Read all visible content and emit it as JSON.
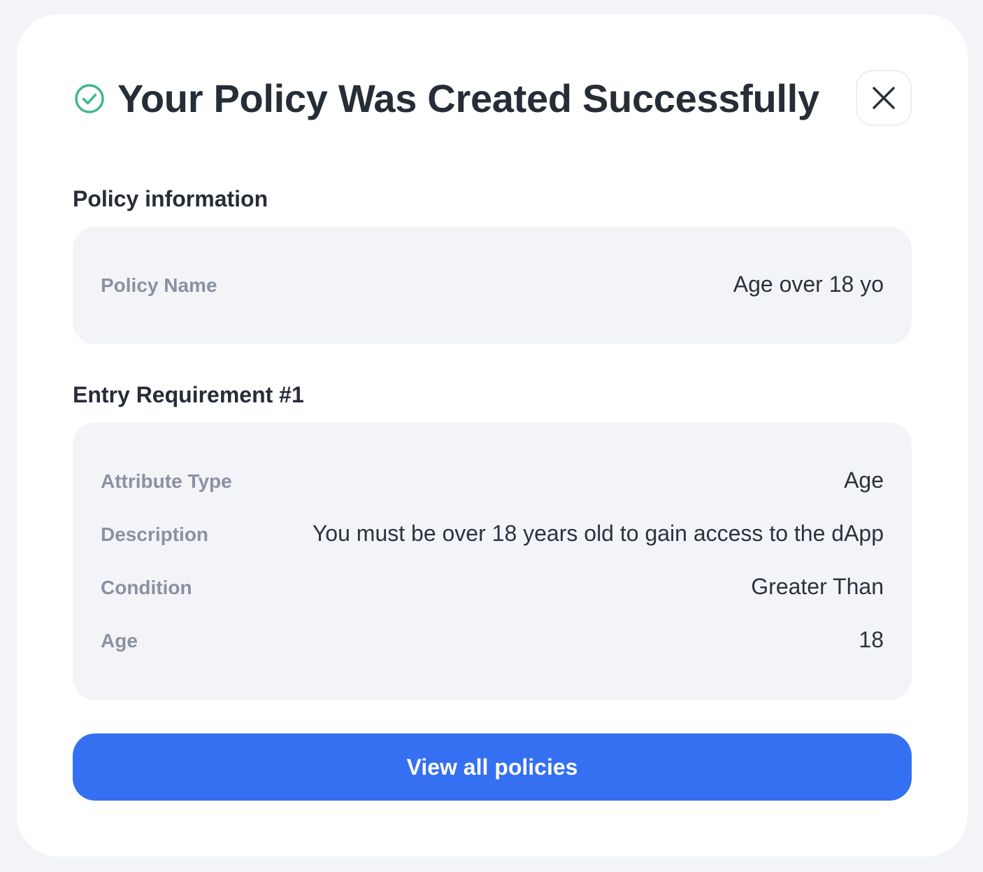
{
  "dialog": {
    "title": "Your Policy Was Created Successfully",
    "success_icon": "check-circle-icon",
    "close_icon": "close-icon",
    "accent_color": "#3fb88a",
    "primary_color": "#356ff2"
  },
  "policy_information": {
    "heading": "Policy information",
    "rows": [
      {
        "label": "Policy Name",
        "value": "Age over 18 yo"
      }
    ]
  },
  "entry_requirement": {
    "heading": "Entry Requirement #1",
    "rows": [
      {
        "label": "Attribute Type",
        "value": "Age"
      },
      {
        "label": "Description",
        "value": "You must be over 18 years old to gain access to the dApp"
      },
      {
        "label": "Condition",
        "value": "Greater Than"
      },
      {
        "label": "Age",
        "value": "18"
      }
    ]
  },
  "actions": {
    "view_all_label": "View all policies"
  }
}
